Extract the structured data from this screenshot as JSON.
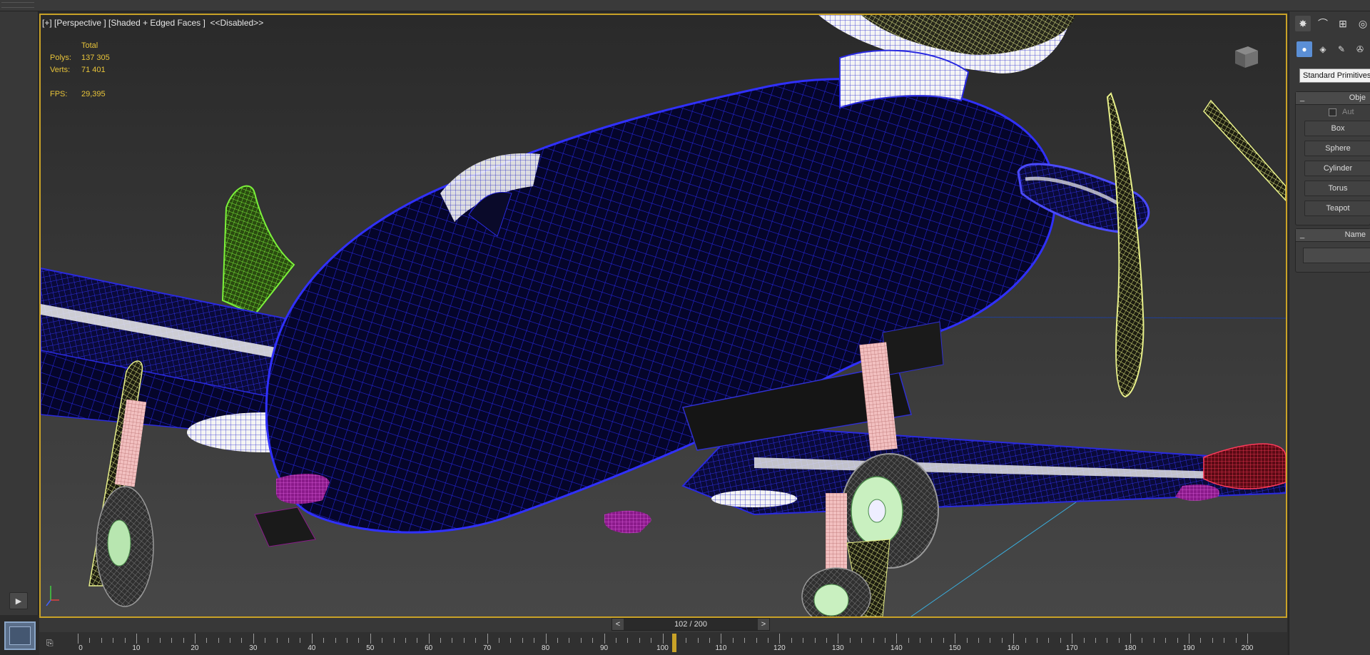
{
  "viewport": {
    "label": "[+] [Perspective ] [Shaded + Edged Faces ]  <<Disabled>>",
    "stats": {
      "header": "Total",
      "polys_label": "Polys:",
      "polys_value": "137 305",
      "verts_label": "Verts:",
      "verts_value": "71 401",
      "fps_label": "FPS:",
      "fps_value": "29,395"
    }
  },
  "command_panel": {
    "dropdown_value": "Standard Primitives",
    "object_type_title": "Obje",
    "autogrid_label": "Aut",
    "buttons": [
      "Box",
      "Sphere",
      "Cylinder",
      "Torus",
      "Teapot"
    ],
    "name_color_title": "Name"
  },
  "timeline": {
    "frame_display": "102 / 200",
    "current_frame": 102,
    "total_frames": 200,
    "prev_arrow": "<",
    "next_arrow": ">",
    "ticks": [
      "0",
      "10",
      "20",
      "30",
      "40",
      "50",
      "60",
      "70",
      "80",
      "90",
      "100",
      "110",
      "120",
      "130",
      "140",
      "150",
      "160",
      "170",
      "180",
      "190",
      "200"
    ]
  },
  "colors": {
    "viewport_border": "#c9a227",
    "fuselage_wire": "#1a1ad9",
    "stats_text": "#e8c43a",
    "gear_pink": "#e8a3a3",
    "prop_yellow": "#e8f08a",
    "fin_green": "#66e02a",
    "light_magenta": "#c030c0"
  },
  "icons": {
    "play": "play-icon",
    "nav_cube": "viewcube-icon",
    "curve_editor": "curve-editor-icon"
  }
}
